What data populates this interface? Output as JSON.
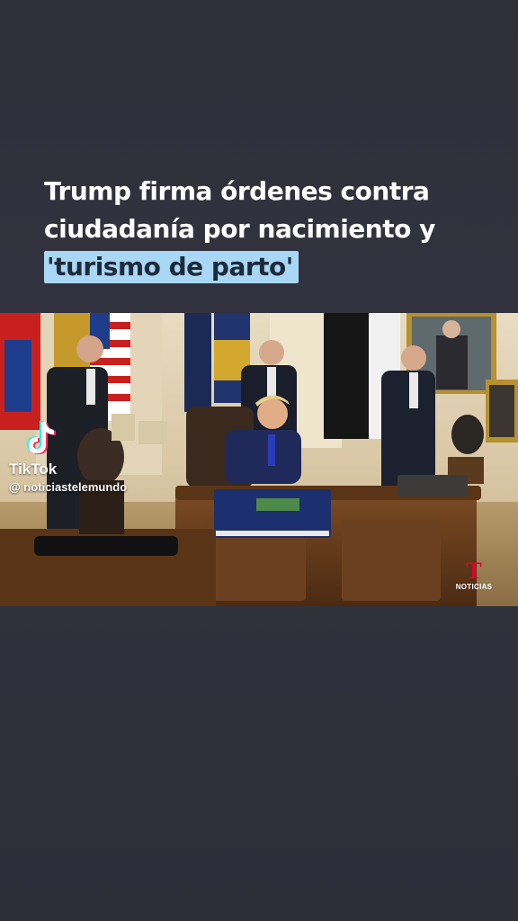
{
  "headline": {
    "line1": "Trump firma órdenes contra",
    "line2": "ciudadanía por nacimiento y",
    "line3": "'turismo de parto'"
  },
  "watermark": {
    "brand": "TikTok",
    "handle": "@ noticiastelemundo",
    "icon": "tiktok-logo-icon"
  },
  "network_logo": {
    "label": "NOTICIAS",
    "icon": "telemundo-t-icon",
    "color": "#e4002b"
  },
  "colors": {
    "background": "#31313c",
    "highlight": "#a9d7f6",
    "text": "#ffffff"
  }
}
